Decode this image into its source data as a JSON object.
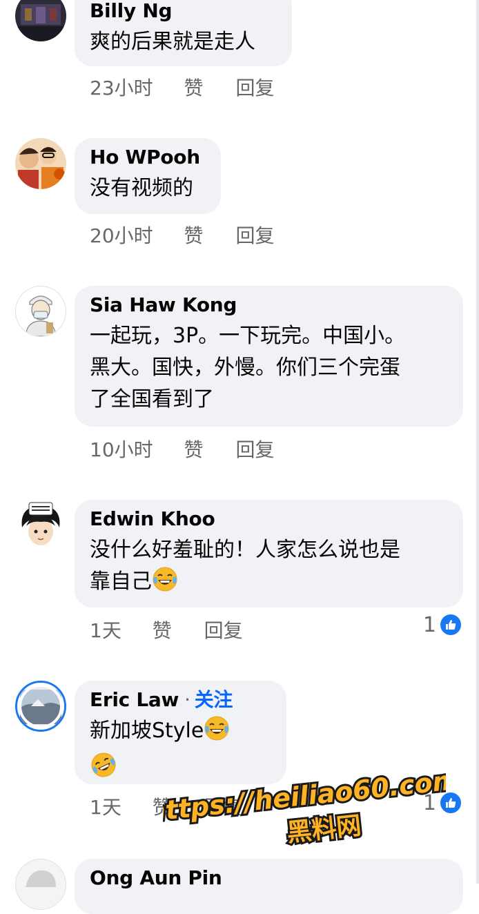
{
  "comments": [
    {
      "author": "Billy Ng",
      "text": "爽的后果就是走人",
      "time": "23小时",
      "like": "赞",
      "reply": "回复"
    },
    {
      "author": "Ho WPooh",
      "text": "没有视频的",
      "time": "20小时",
      "like": "赞",
      "reply": "回复"
    },
    {
      "author": "Sia Haw Kong",
      "line1": "一起玩，3P。一下玩完。中国小。",
      "line2": "黑大。国快，外慢。你们三个完蛋",
      "line3": "了全国看到了",
      "time": "10小时",
      "like": "赞",
      "reply": "回复"
    },
    {
      "author": "Edwin Khoo",
      "line1": "没什么好羞耻的！人家怎么说也是",
      "line2": "靠自己",
      "time": "1天",
      "like": "赞",
      "reply": "回复",
      "reaction_count": "1"
    },
    {
      "author": "Eric Law",
      "dot": "·",
      "follow": "关注",
      "line1": "新加坡Style",
      "time": "1天",
      "like": "赞",
      "reply": "回复",
      "reaction_count": "1"
    },
    {
      "author": "Ong Aun Pin"
    }
  ],
  "watermark": {
    "url": "https://heiliao60.com",
    "name": "黑料网"
  },
  "colors": {
    "bubble": "#f0f2f5",
    "meta": "#65676b",
    "follow": "#0866ff",
    "like_badge": "#1877f2",
    "watermark_fill": "#ffb324",
    "watermark_stroke": "#1a1a1a"
  },
  "icons": {
    "laugh": "laughing-tears-emoji",
    "like": "thumbs-up-icon"
  }
}
